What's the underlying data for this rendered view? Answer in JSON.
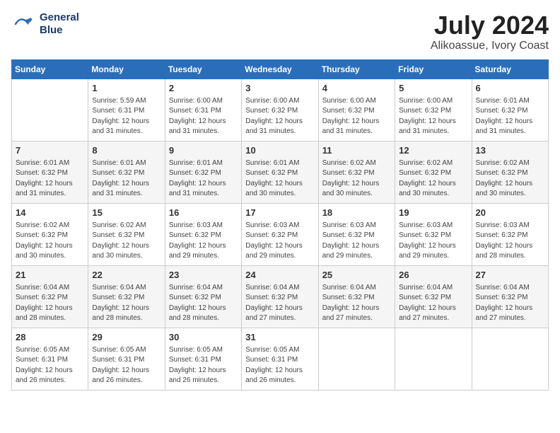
{
  "header": {
    "logo_line1": "General",
    "logo_line2": "Blue",
    "month_year": "July 2024",
    "location": "Alikoassue, Ivory Coast"
  },
  "days_of_week": [
    "Sunday",
    "Monday",
    "Tuesday",
    "Wednesday",
    "Thursday",
    "Friday",
    "Saturday"
  ],
  "weeks": [
    [
      {
        "day": "",
        "info": ""
      },
      {
        "day": "1",
        "info": "Sunrise: 5:59 AM\nSunset: 6:31 PM\nDaylight: 12 hours\nand 31 minutes."
      },
      {
        "day": "2",
        "info": "Sunrise: 6:00 AM\nSunset: 6:31 PM\nDaylight: 12 hours\nand 31 minutes."
      },
      {
        "day": "3",
        "info": "Sunrise: 6:00 AM\nSunset: 6:32 PM\nDaylight: 12 hours\nand 31 minutes."
      },
      {
        "day": "4",
        "info": "Sunrise: 6:00 AM\nSunset: 6:32 PM\nDaylight: 12 hours\nand 31 minutes."
      },
      {
        "day": "5",
        "info": "Sunrise: 6:00 AM\nSunset: 6:32 PM\nDaylight: 12 hours\nand 31 minutes."
      },
      {
        "day": "6",
        "info": "Sunrise: 6:01 AM\nSunset: 6:32 PM\nDaylight: 12 hours\nand 31 minutes."
      }
    ],
    [
      {
        "day": "7",
        "info": "Sunrise: 6:01 AM\nSunset: 6:32 PM\nDaylight: 12 hours\nand 31 minutes."
      },
      {
        "day": "8",
        "info": "Sunrise: 6:01 AM\nSunset: 6:32 PM\nDaylight: 12 hours\nand 31 minutes."
      },
      {
        "day": "9",
        "info": "Sunrise: 6:01 AM\nSunset: 6:32 PM\nDaylight: 12 hours\nand 31 minutes."
      },
      {
        "day": "10",
        "info": "Sunrise: 6:01 AM\nSunset: 6:32 PM\nDaylight: 12 hours\nand 30 minutes."
      },
      {
        "day": "11",
        "info": "Sunrise: 6:02 AM\nSunset: 6:32 PM\nDaylight: 12 hours\nand 30 minutes."
      },
      {
        "day": "12",
        "info": "Sunrise: 6:02 AM\nSunset: 6:32 PM\nDaylight: 12 hours\nand 30 minutes."
      },
      {
        "day": "13",
        "info": "Sunrise: 6:02 AM\nSunset: 6:32 PM\nDaylight: 12 hours\nand 30 minutes."
      }
    ],
    [
      {
        "day": "14",
        "info": "Sunrise: 6:02 AM\nSunset: 6:32 PM\nDaylight: 12 hours\nand 30 minutes."
      },
      {
        "day": "15",
        "info": "Sunrise: 6:02 AM\nSunset: 6:32 PM\nDaylight: 12 hours\nand 30 minutes."
      },
      {
        "day": "16",
        "info": "Sunrise: 6:03 AM\nSunset: 6:32 PM\nDaylight: 12 hours\nand 29 minutes."
      },
      {
        "day": "17",
        "info": "Sunrise: 6:03 AM\nSunset: 6:32 PM\nDaylight: 12 hours\nand 29 minutes."
      },
      {
        "day": "18",
        "info": "Sunrise: 6:03 AM\nSunset: 6:32 PM\nDaylight: 12 hours\nand 29 minutes."
      },
      {
        "day": "19",
        "info": "Sunrise: 6:03 AM\nSunset: 6:32 PM\nDaylight: 12 hours\nand 29 minutes."
      },
      {
        "day": "20",
        "info": "Sunrise: 6:03 AM\nSunset: 6:32 PM\nDaylight: 12 hours\nand 28 minutes."
      }
    ],
    [
      {
        "day": "21",
        "info": "Sunrise: 6:04 AM\nSunset: 6:32 PM\nDaylight: 12 hours\nand 28 minutes."
      },
      {
        "day": "22",
        "info": "Sunrise: 6:04 AM\nSunset: 6:32 PM\nDaylight: 12 hours\nand 28 minutes."
      },
      {
        "day": "23",
        "info": "Sunrise: 6:04 AM\nSunset: 6:32 PM\nDaylight: 12 hours\nand 28 minutes."
      },
      {
        "day": "24",
        "info": "Sunrise: 6:04 AM\nSunset: 6:32 PM\nDaylight: 12 hours\nand 27 minutes."
      },
      {
        "day": "25",
        "info": "Sunrise: 6:04 AM\nSunset: 6:32 PM\nDaylight: 12 hours\nand 27 minutes."
      },
      {
        "day": "26",
        "info": "Sunrise: 6:04 AM\nSunset: 6:32 PM\nDaylight: 12 hours\nand 27 minutes."
      },
      {
        "day": "27",
        "info": "Sunrise: 6:04 AM\nSunset: 6:32 PM\nDaylight: 12 hours\nand 27 minutes."
      }
    ],
    [
      {
        "day": "28",
        "info": "Sunrise: 6:05 AM\nSunset: 6:31 PM\nDaylight: 12 hours\nand 26 minutes."
      },
      {
        "day": "29",
        "info": "Sunrise: 6:05 AM\nSunset: 6:31 PM\nDaylight: 12 hours\nand 26 minutes."
      },
      {
        "day": "30",
        "info": "Sunrise: 6:05 AM\nSunset: 6:31 PM\nDaylight: 12 hours\nand 26 minutes."
      },
      {
        "day": "31",
        "info": "Sunrise: 6:05 AM\nSunset: 6:31 PM\nDaylight: 12 hours\nand 26 minutes."
      },
      {
        "day": "",
        "info": ""
      },
      {
        "day": "",
        "info": ""
      },
      {
        "day": "",
        "info": ""
      }
    ]
  ]
}
